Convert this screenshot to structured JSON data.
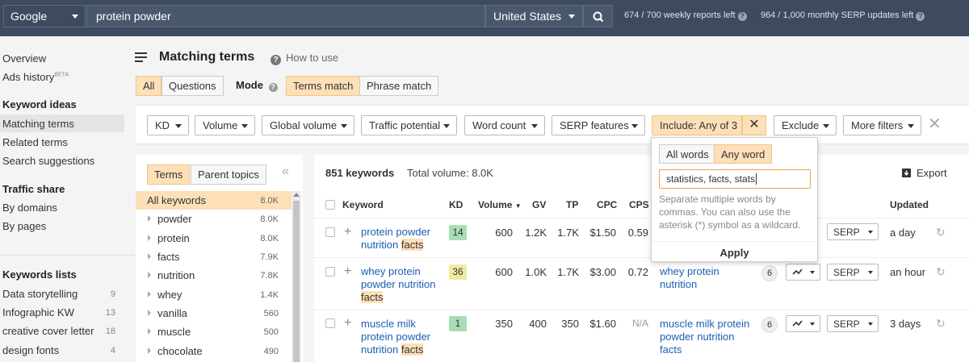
{
  "topbar": {
    "engine": "Google",
    "query": "protein powder",
    "country": "United States",
    "weekly_quota": "674 / 700 weekly reports left",
    "monthly_quota": "964 / 1,000 monthly SERP updates left"
  },
  "sidebar": {
    "overview": "Overview",
    "ads_history": "Ads history",
    "beta": "BETA",
    "keyword_ideas_heading": "Keyword ideas",
    "matching_terms": "Matching terms",
    "related_terms": "Related terms",
    "search_suggestions": "Search suggestions",
    "traffic_share_heading": "Traffic share",
    "by_domains": "By domains",
    "by_pages": "By pages",
    "keywords_lists_heading": "Keywords lists",
    "lists": [
      {
        "name": "Data storytelling",
        "count": "9"
      },
      {
        "name": "Infographic KW",
        "count": "13"
      },
      {
        "name": "creative cover letter",
        "count": "18"
      },
      {
        "name": "design fonts",
        "count": "4"
      }
    ]
  },
  "header": {
    "title": "Matching terms",
    "how_to": "How to use",
    "tab_all": "All",
    "tab_questions": "Questions",
    "mode_label": "Mode",
    "mode_terms": "Terms match",
    "mode_phrase": "Phrase match"
  },
  "filters": {
    "kd": "KD",
    "volume": "Volume",
    "global_volume": "Global volume",
    "traffic_potential": "Traffic potential",
    "word_count": "Word count",
    "serp_features": "SERP features",
    "include": "Include: Any of 3",
    "exclude": "Exclude",
    "more_filters": "More filters"
  },
  "include_popover": {
    "all_words": "All words",
    "any_word": "Any word",
    "input_value": "statistics, facts, stats",
    "help": "Separate multiple words by commas. You can also use the asterisk (*) symbol as a wildcard.",
    "apply": "Apply"
  },
  "terms_panel": {
    "tab_terms": "Terms",
    "tab_parent": "Parent topics",
    "rows": [
      {
        "label": "All keywords",
        "count": "8.0K"
      },
      {
        "label": "powder",
        "count": "8.0K"
      },
      {
        "label": "protein",
        "count": "8.0K"
      },
      {
        "label": "facts",
        "count": "7.9K"
      },
      {
        "label": "nutrition",
        "count": "7.8K"
      },
      {
        "label": "whey",
        "count": "1.4K"
      },
      {
        "label": "vanilla",
        "count": "560"
      },
      {
        "label": "muscle",
        "count": "500"
      },
      {
        "label": "chocolate",
        "count": "490"
      }
    ]
  },
  "results": {
    "count": "851 keywords",
    "total_volume": "Total volume: 8.0K",
    "export": "Export",
    "columns": {
      "keyword": "Keyword",
      "kd": "KD",
      "volume": "Volume",
      "gv": "GV",
      "tp": "TP",
      "cpc": "CPC",
      "cps": "CPS",
      "updated": "Updated"
    },
    "rows": [
      {
        "kw_a": "protein powder",
        "kw_b": "nutrition ",
        "kw_hl": "facts",
        "kw_c": "",
        "kd": "14",
        "kd_color": "#a8ddb5",
        "volume": "600",
        "gv": "1.2K",
        "tp": "1.7K",
        "cpc": "$1.50",
        "cps": "0.59",
        "parent": "",
        "parent_count": "",
        "serp": "SERP",
        "updated": "a day"
      },
      {
        "kw_a": "whey protein",
        "kw_b": "powder nutrition",
        "kw_hl": "facts",
        "kw_c": "",
        "kd": "36",
        "kd_color": "#f2e9a0",
        "volume": "600",
        "gv": "1.0K",
        "tp": "1.7K",
        "cpc": "$3.00",
        "cps": "0.72",
        "parent": "whey protein nutrition",
        "parent_count": "6",
        "serp": "SERP",
        "updated": "an hour"
      },
      {
        "kw_a": "muscle milk",
        "kw_b": "protein powder",
        "kw_hl": "facts",
        "kw_c": "nutrition ",
        "kd": "1",
        "kd_color": "#a8ddb5",
        "volume": "350",
        "gv": "400",
        "tp": "350",
        "cpc": "$1.60",
        "cps": "N/A",
        "parent": "muscle milk protein powder nutrition facts",
        "parent_count": "6",
        "serp": "SERP",
        "updated": "3 days"
      }
    ]
  }
}
